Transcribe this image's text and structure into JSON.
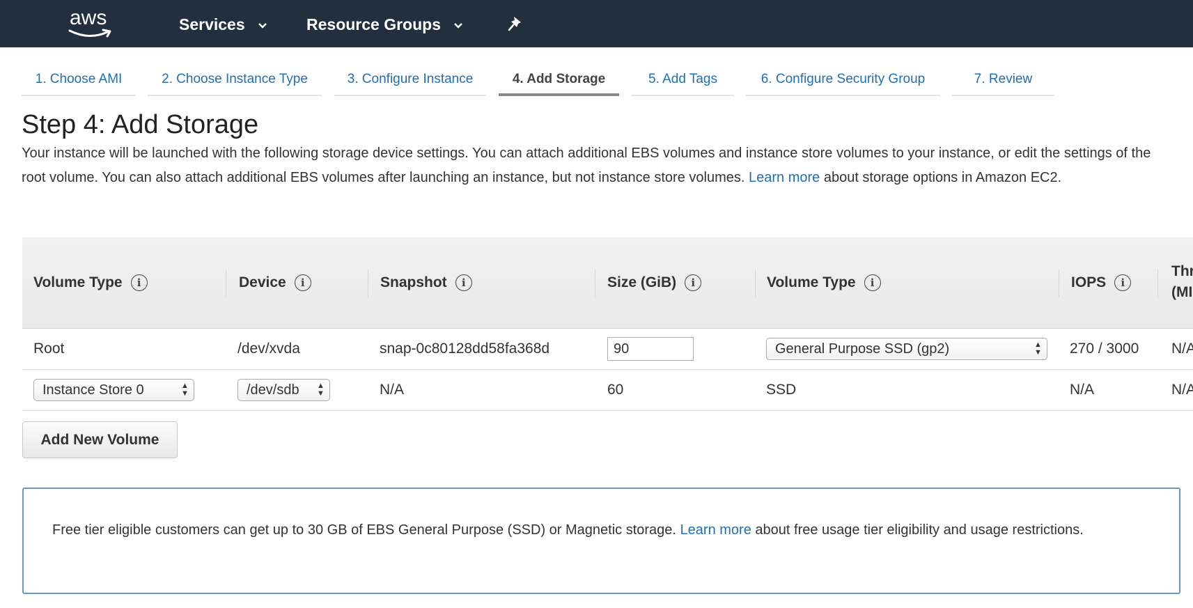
{
  "nav": {
    "logo_text": "aws",
    "services": "Services",
    "resource_groups": "Resource Groups"
  },
  "tabs": [
    {
      "label": "1. Choose AMI"
    },
    {
      "label": "2. Choose Instance Type"
    },
    {
      "label": "3. Configure Instance"
    },
    {
      "label": "4. Add Storage",
      "active": true
    },
    {
      "label": "5. Add Tags"
    },
    {
      "label": "6. Configure Security Group"
    },
    {
      "label": "7. Review"
    }
  ],
  "page": {
    "title": "Step 4: Add Storage",
    "desc_text": "Your instance will be launched with the following storage device settings. You can attach additional EBS volumes and instance store volumes to your instance, or edit the settings of the root volume. You can also attach additional EBS volumes after launching an instance, but not instance store volumes.",
    "desc_link": "Learn more",
    "desc_tail": "about storage options in Amazon EC2."
  },
  "table": {
    "headers": [
      "Volume Type",
      "Device",
      "Snapshot",
      "Size (GiB)",
      "Volume Type",
      "IOPS",
      "Thr",
      "(MI"
    ],
    "info_glyph": "i",
    "rows": [
      {
        "volume_type": "Root",
        "device": "/dev/xvda",
        "snapshot": "snap-0c80128dd58fa368d",
        "size": "90",
        "ebs_type": "General Purpose SSD (gp2)",
        "iops": "270 / 3000",
        "throughput": "N/A"
      },
      {
        "volume_type": "Instance Store 0",
        "device": "/dev/sdb",
        "snapshot": "N/A",
        "size": "60",
        "ebs_type": "SSD",
        "iops": "N/A",
        "throughput": "N/A"
      }
    ]
  },
  "buttons": {
    "add_volume": "Add New Volume"
  },
  "info_box": {
    "text": "Free tier eligible customers can get up to 30 GB of EBS General Purpose (SSD) or Magnetic storage.",
    "link": "Learn more",
    "tail": "about free usage tier eligibility and usage restrictions."
  },
  "colors": {
    "nav_bg": "#232f3e",
    "link": "#1f6fb5",
    "info_border": "#6a96c0"
  }
}
